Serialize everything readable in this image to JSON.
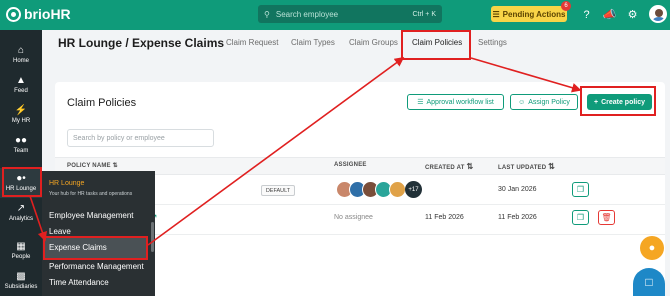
{
  "topbar": {
    "logo_text": "brioHR",
    "search_placeholder": "Search employee",
    "search_shortcut": "Ctrl + K",
    "pending_label": "Pending Actions",
    "pending_count": "6",
    "brand_color": "#0f9b7a"
  },
  "sidebar": {
    "items": [
      {
        "label": "Home",
        "icon": "home-icon"
      },
      {
        "label": "Feed",
        "icon": "megaphone-icon"
      },
      {
        "label": "My HR",
        "icon": "bolt-icon"
      },
      {
        "label": "Team",
        "icon": "team-icon"
      },
      {
        "label": "HR Lounge",
        "icon": "hr-lounge-icon"
      },
      {
        "label": "Analytics",
        "icon": "chart-icon"
      },
      {
        "label": "People",
        "icon": "people-icon"
      },
      {
        "label": "Subsidiaries",
        "icon": "building-icon"
      }
    ]
  },
  "header": {
    "breadcrumb": "HR Lounge  /  Expense Claims",
    "tabs": [
      {
        "label": "Claim Request"
      },
      {
        "label": "Claim Types"
      },
      {
        "label": "Claim Groups"
      },
      {
        "label": "Claim Policies"
      },
      {
        "label": "Settings"
      }
    ],
    "active_tab": "Claim Policies"
  },
  "main": {
    "title": "Claim Policies",
    "approval_button": "Approval workflow list",
    "assign_button": "Assign Policy",
    "create_button": "Create policy",
    "search_placeholder": "Search by policy or employee",
    "columns": {
      "policy_name": "POLICY NAME",
      "assignee": "ASSIGNEE",
      "created_at": "CREATED AT",
      "last_updated": "LAST UPDATED"
    },
    "rows": [
      {
        "badge": "DEFAULT",
        "assignee_extra": "+17",
        "created_at": "",
        "last_updated": "30 Jan 2026"
      },
      {
        "badge": "",
        "assignee": "No assignee",
        "created_at": "11 Feb 2026",
        "last_updated": "11 Feb 2026"
      }
    ]
  },
  "flyout": {
    "title": "HR Lounge",
    "subtitle": "Your hub for HR tasks and operations",
    "items": [
      {
        "label": "Employee Management"
      },
      {
        "label": "Leave"
      },
      {
        "label": "Expense Claims"
      },
      {
        "label": "Performance Management"
      },
      {
        "label": "Time Attendance"
      }
    ],
    "highlighted": "Expense Claims"
  },
  "annotation_color": "#e02020"
}
